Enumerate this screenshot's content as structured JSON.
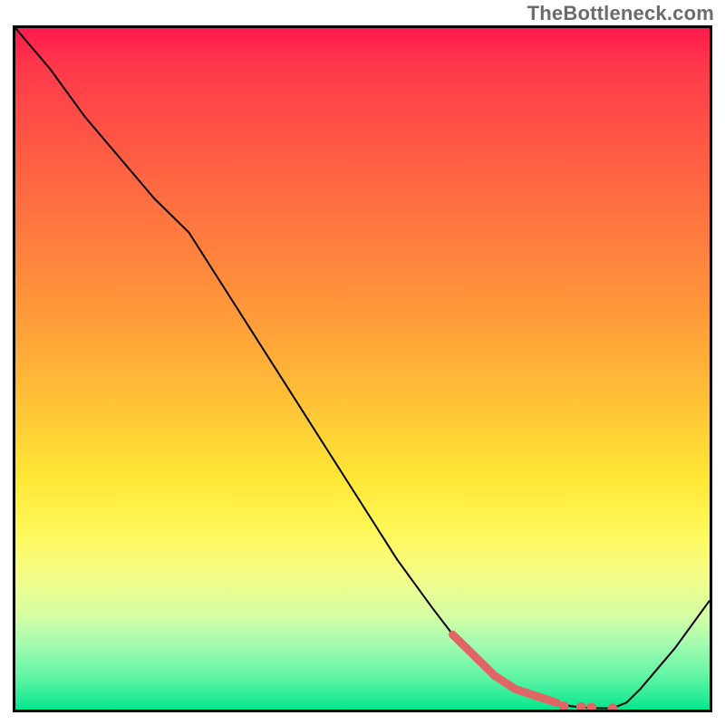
{
  "watermark": "TheBottleneck.com",
  "chart_data": {
    "type": "line",
    "title": "",
    "xlabel": "",
    "ylabel": "",
    "xlim": [
      0,
      100
    ],
    "ylim": [
      0,
      100
    ],
    "grid": false,
    "legend": false,
    "series": [
      {
        "name": "bottleneck-curve",
        "color": "#000000",
        "x": [
          0,
          5,
          10,
          15,
          20,
          25,
          30,
          35,
          40,
          45,
          50,
          55,
          60,
          63,
          66,
          69,
          72,
          75,
          78,
          80,
          82,
          84,
          86,
          88,
          90,
          95,
          100
        ],
        "y": [
          100,
          94,
          87,
          81,
          75,
          70,
          62,
          54,
          46,
          38,
          30,
          22,
          15,
          11,
          8,
          5,
          3,
          2,
          1,
          0.5,
          0.3,
          0.2,
          0.2,
          1,
          3,
          9,
          16
        ]
      }
    ],
    "highlight": {
      "name": "near-optimum-band",
      "color": "#E06666",
      "x": [
        63,
        66,
        69,
        72,
        75,
        78
      ],
      "y": [
        11,
        8,
        5,
        3,
        2,
        1
      ]
    },
    "highlight_dots": {
      "name": "optimum-points",
      "color": "#E06666",
      "points": [
        {
          "x": 79,
          "y": 0.5
        },
        {
          "x": 81.5,
          "y": 0.4
        },
        {
          "x": 83,
          "y": 0.3
        },
        {
          "x": 86,
          "y": 0.2
        }
      ]
    },
    "background_gradient": {
      "top": "#ff1a4d",
      "mid": "#ffe736",
      "bottom": "#00e48e"
    }
  }
}
